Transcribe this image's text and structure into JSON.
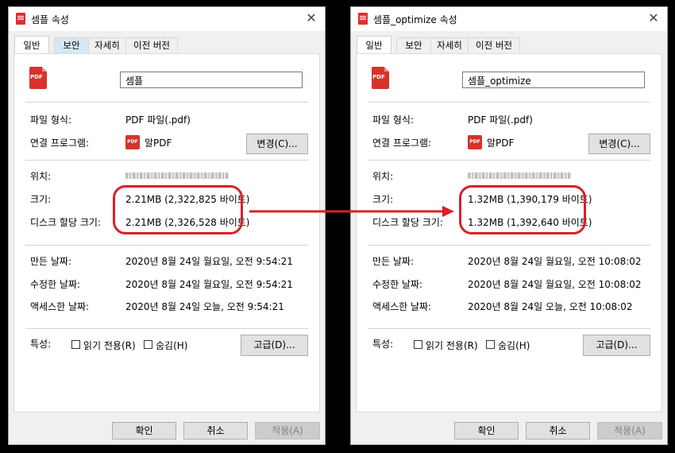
{
  "windows": [
    {
      "title": "셈플 속성",
      "tabs": [
        "일반",
        "보안",
        "자세히",
        "이전 버전"
      ],
      "file_name": "셈플",
      "labels": {
        "type": "파일 형식:",
        "program": "연결 프로그램:",
        "location": "위치:",
        "size": "크기:",
        "disk_size": "디스크 할당 크기:",
        "created": "만든 날짜:",
        "modified": "수정한 날짜:",
        "accessed": "액세스한 날짜:",
        "attributes": "특성:"
      },
      "values": {
        "type": "PDF 파일(.pdf)",
        "program": "알PDF",
        "size": "2.21MB (2,322,825 바이트)",
        "disk_size": "2.21MB (2,326,528 바이트)",
        "created": "2020년 8월 24일 월요일, 오전 9:54:21",
        "modified": "2020년 8월 24일 월요일, 오전 9:54:21",
        "accessed": "2020년 8월 24일 오늘, 오전 9:54:21"
      },
      "change_button": "변경(C)...",
      "readonly_label": "읽기 전용(R)",
      "hidden_label": "숨김(H)",
      "advanced_button": "고급(D)...",
      "ok_button": "확인",
      "cancel_button": "취소",
      "apply_button": "적용(A)"
    },
    {
      "title": "셈플_optimize 속성",
      "tabs": [
        "일반",
        "보안",
        "자세히",
        "이전 버전"
      ],
      "file_name": "셈플_optimize",
      "labels": {
        "type": "파일 형식:",
        "program": "연결 프로그램:",
        "location": "위치:",
        "size": "크기:",
        "disk_size": "디스크 할당 크기:",
        "created": "만든 날짜:",
        "modified": "수정한 날짜:",
        "accessed": "액세스한 날짜:",
        "attributes": "특성:"
      },
      "values": {
        "type": "PDF 파일(.pdf)",
        "program": "알PDF",
        "size": "1.32MB (1,390,179 바이트)",
        "disk_size": "1.32MB (1,392,640 바이트)",
        "created": "2020년 8월 24일 월요일, 오전 10:08:02",
        "modified": "2020년 8월 24일 월요일, 오전 10:08:02",
        "accessed": "2020년 8월 24일 오늘, 오전 10:08:02"
      },
      "change_button": "변경(C)...",
      "readonly_label": "읽기 전용(R)",
      "hidden_label": "숨김(H)",
      "advanced_button": "고급(D)...",
      "ok_button": "확인",
      "cancel_button": "취소",
      "apply_button": "적용(A)"
    }
  ],
  "colors": {
    "highlight": "#d8202a",
    "pdf_red": "#d9312b",
    "tab_hover": "#d6e8f7"
  }
}
